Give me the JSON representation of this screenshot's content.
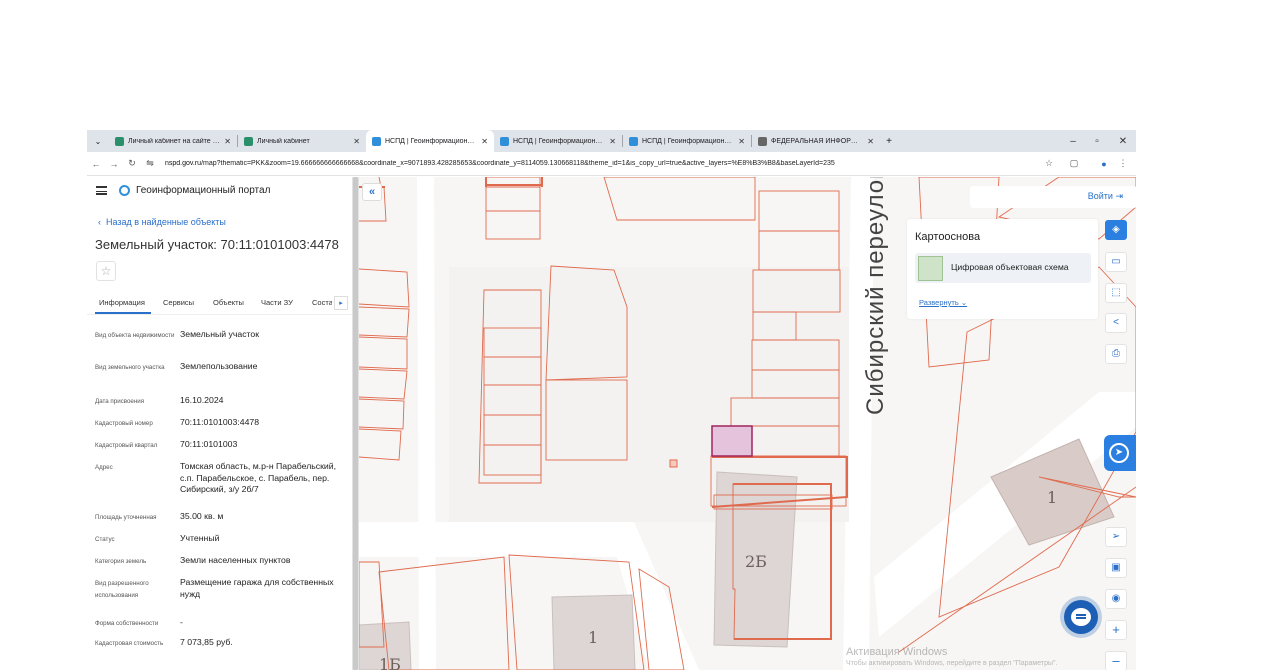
{
  "browser": {
    "tabs": [
      {
        "title": "Личный кабинет на сайте Рос",
        "favicon_color": "#2a8f6a",
        "active": false
      },
      {
        "title": "Личный кабинет",
        "favicon_color": "#2a8f6a",
        "active": false
      },
      {
        "title": "НСПД | Геоинформационный",
        "favicon_color": "#2f8fd8",
        "active": true
      },
      {
        "title": "НСПД | Геоинформационный",
        "favicon_color": "#2f8fd8",
        "active": false
      },
      {
        "title": "НСПД | Геоинформационный",
        "favicon_color": "#2f8fd8",
        "active": false
      },
      {
        "title": "ФЕДЕРАЛЬНАЯ ИНФОРМАЦИ",
        "favicon_color": "#666666",
        "active": false
      }
    ],
    "new_tab_label": "+",
    "url_host": "nspd.gov.ru",
    "url_rest": "/map?thematic=PKK&zoom=19.666666666666668&coordinate_x=9071893.428285653&coordinate_y=8114059.130668118&theme_id=1&is_copy_url=true&active_layers=%E8%B3%B8&baseLayerId=235"
  },
  "panel": {
    "portal_title": "Геоинформационный портал",
    "back_link": "Назад в найденные объекты",
    "object_title": "Земельный участок: 70:11:0101003:4478",
    "tabs": [
      "Информация",
      "Сервисы",
      "Объекты",
      "Части ЗУ",
      "Соста"
    ],
    "rows": [
      {
        "label": "Вид объекта недвижимости",
        "value": "Земельный участок"
      },
      {
        "label": "Вид земельного участка",
        "value": "Землепользование"
      },
      {
        "label": "Дата присвоения",
        "value": "16.10.2024"
      },
      {
        "label": "Кадастровый номер",
        "value": "70:11:0101003:4478"
      },
      {
        "label": "Кадастровый квартал",
        "value": "70:11:0101003"
      },
      {
        "label": "Адрес",
        "value": "Томская область, м.р-н Парабельский, с.п. Парабельское, с. Парабель, пер. Сибирский, з/у 2б/7"
      },
      {
        "label": "Площадь уточненная",
        "value": "35.00 кв. м"
      },
      {
        "label": "Статус",
        "value": "Учтенный"
      },
      {
        "label": "Категория земель",
        "value": "Земли населенных пунктов"
      },
      {
        "label": "Вид разрешенного использования",
        "value": "Размещение гаража для собственных нужд"
      },
      {
        "label": "Форма собственности",
        "value": "-"
      },
      {
        "label": "Кадастровая стоимость",
        "value": "7 073,85 руб."
      }
    ]
  },
  "map": {
    "login": "Войти",
    "basemap_title": "Картооснова",
    "basemap_item": "Цифровая объектовая схема",
    "basemap_expand": "Развернуть",
    "street_label": "Сибирский переулок",
    "building_labels": [
      "1",
      "2Б",
      "1",
      "1Б"
    ],
    "watermark_title": "Активация Windows",
    "watermark_sub": "Чтобы активировать Windows, перейдите в раздел \"Параметры\".",
    "parcel_color": "#e06a4e",
    "selected_fill": "#e6c3dd",
    "selected_stroke": "#a0245e",
    "accent": "#2a7fe0"
  }
}
